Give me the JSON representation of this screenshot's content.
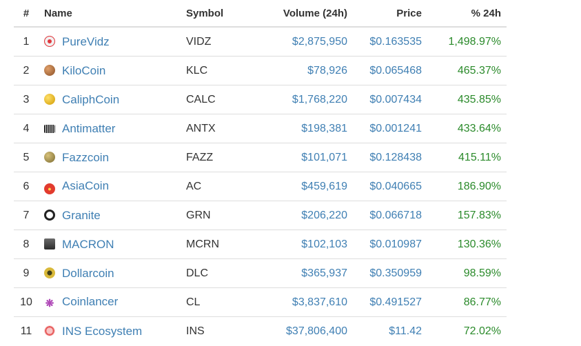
{
  "table": {
    "headers": {
      "rank": "#",
      "name": "Name",
      "symbol": "Symbol",
      "volume": "Volume (24h)",
      "price": "Price",
      "change": "% 24h"
    },
    "rows": [
      {
        "rank": "1",
        "name": "PureVidz",
        "symbol": "VIDZ",
        "volume": "$2,875,950",
        "price": "$0.163535",
        "change": "1,498.97%",
        "icon": "purevidz-icon"
      },
      {
        "rank": "2",
        "name": "KiloCoin",
        "symbol": "KLC",
        "volume": "$78,926",
        "price": "$0.065468",
        "change": "465.37%",
        "icon": "kilocoin-icon"
      },
      {
        "rank": "3",
        "name": "CaliphCoin",
        "symbol": "CALC",
        "volume": "$1,768,220",
        "price": "$0.007434",
        "change": "435.85%",
        "icon": "caliphcoin-icon"
      },
      {
        "rank": "4",
        "name": "Antimatter",
        "symbol": "ANTX",
        "volume": "$198,381",
        "price": "$0.001241",
        "change": "433.64%",
        "icon": "antimatter-icon"
      },
      {
        "rank": "5",
        "name": "Fazzcoin",
        "symbol": "FAZZ",
        "volume": "$101,071",
        "price": "$0.128438",
        "change": "415.11%",
        "icon": "fazzcoin-icon"
      },
      {
        "rank": "6",
        "name": "AsiaCoin",
        "symbol": "AC",
        "volume": "$459,619",
        "price": "$0.040665",
        "change": "186.90%",
        "icon": "asiacoin-icon"
      },
      {
        "rank": "7",
        "name": "Granite",
        "symbol": "GRN",
        "volume": "$206,220",
        "price": "$0.066718",
        "change": "157.83%",
        "icon": "granite-icon"
      },
      {
        "rank": "8",
        "name": "MACRON",
        "symbol": "MCRN",
        "volume": "$102,103",
        "price": "$0.010987",
        "change": "130.36%",
        "icon": "macron-icon"
      },
      {
        "rank": "9",
        "name": "Dollarcoin",
        "symbol": "DLC",
        "volume": "$365,937",
        "price": "$0.350959",
        "change": "98.59%",
        "icon": "dollarcoin-icon"
      },
      {
        "rank": "10",
        "name": "Coinlancer",
        "symbol": "CL",
        "volume": "$3,837,610",
        "price": "$0.491527",
        "change": "86.77%",
        "icon": "coinlancer-icon"
      },
      {
        "rank": "11",
        "name": "INS Ecosystem",
        "symbol": "INS",
        "volume": "$37,806,400",
        "price": "$11.42",
        "change": "72.02%",
        "icon": "ins-ecosystem-icon"
      }
    ]
  },
  "colors": {
    "link": "#3f7fb3",
    "positive": "#2a8a2a",
    "border": "#dddddd",
    "text": "#333333"
  }
}
